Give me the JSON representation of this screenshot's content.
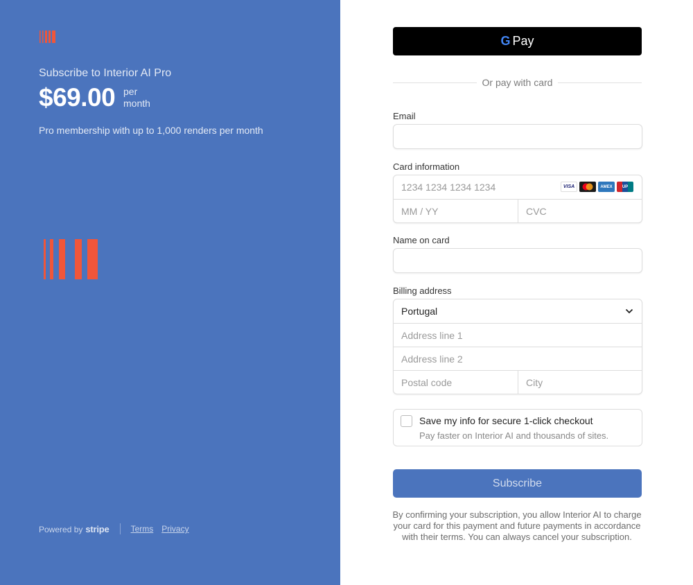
{
  "summary": {
    "product_title": "Subscribe to Interior AI Pro",
    "price": "$69.00",
    "period_line1": "per",
    "period_line2": "month",
    "description": "Pro membership with up to 1,000 renders per month",
    "brand_color": "#4b74bd",
    "logo_color": "#f0563a"
  },
  "footer": {
    "powered_by": "Powered by",
    "stripe": "stripe",
    "terms": "Terms",
    "privacy": "Privacy"
  },
  "payment": {
    "gpay_label": "Pay",
    "or_text": "Or pay with card"
  },
  "form": {
    "email_label": "Email",
    "email_value": "",
    "card_label": "Card information",
    "card_number_placeholder": "1234 1234 1234 1234",
    "expiry_placeholder": "MM / YY",
    "cvc_placeholder": "CVC",
    "card_brands": [
      "VISA",
      "mastercard",
      "amex",
      "unionpay"
    ],
    "name_label": "Name on card",
    "name_value": "",
    "billing_label": "Billing address",
    "country_value": "Portugal",
    "address1_placeholder": "Address line 1",
    "address2_placeholder": "Address line 2",
    "postal_placeholder": "Postal code",
    "city_placeholder": "City"
  },
  "save_info": {
    "title": "Save my info for secure 1-click checkout",
    "subtitle": "Pay faster on Interior AI and thousands of sites.",
    "checked": false
  },
  "subscribe_label": "Subscribe",
  "legal_text": "By confirming your subscription, you allow Interior AI to charge your card for this payment and future payments in accordance with their terms. You can always cancel your subscription."
}
